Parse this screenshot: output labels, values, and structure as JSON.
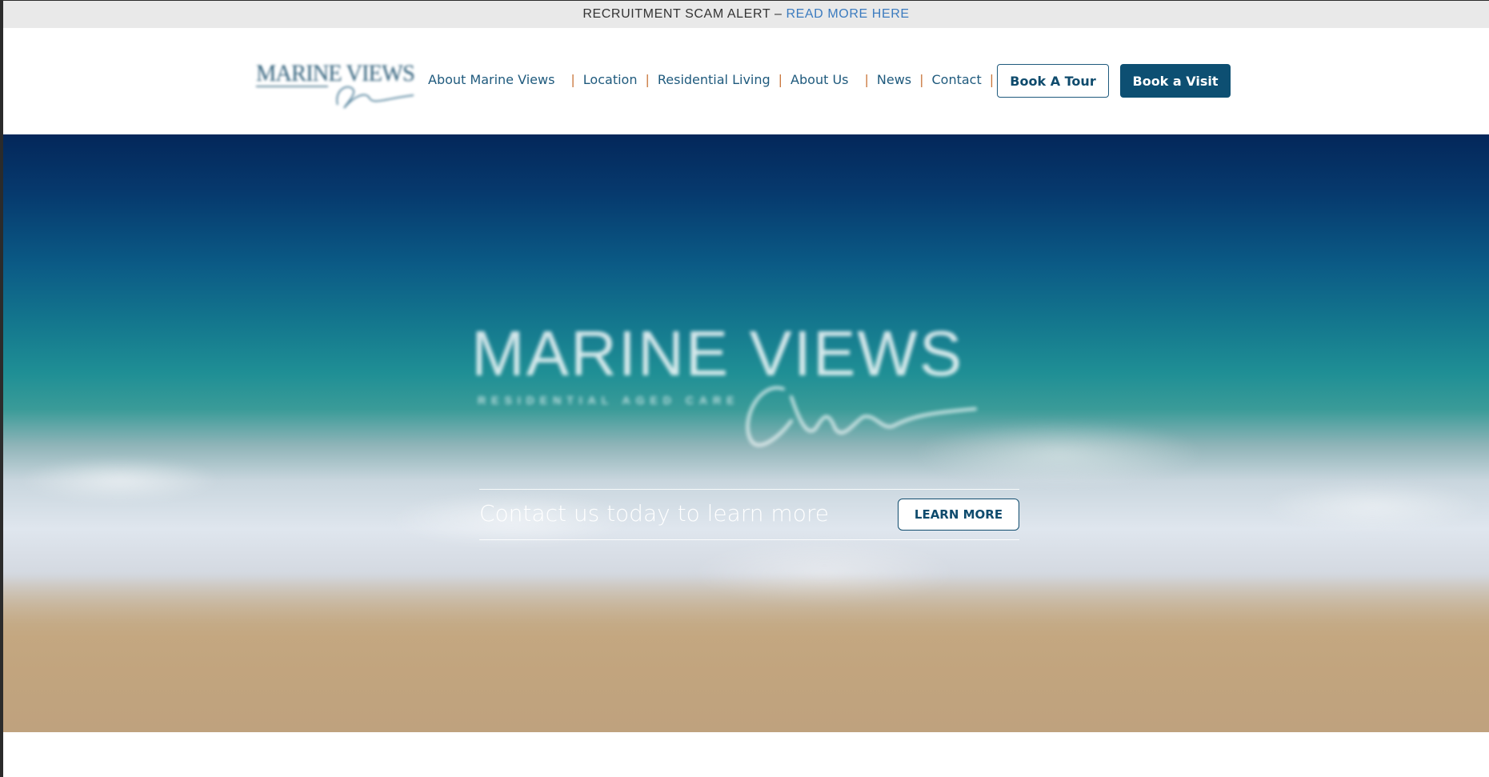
{
  "alert": {
    "text": "RECRUITMENT SCAM ALERT –",
    "link": "READ MORE HERE"
  },
  "header": {
    "logo_alt": "MARINE VIEWS",
    "nav": [
      {
        "label": "About Marine Views"
      },
      {
        "label": "Location"
      },
      {
        "label": "Residential Living"
      },
      {
        "label": "About Us"
      },
      {
        "label": "News"
      },
      {
        "label": "Contact"
      }
    ],
    "separator": "|",
    "book_tour_label": "Book A Tour",
    "book_visit_label": "Book a Visit"
  },
  "hero": {
    "logo_title": "MARINE VIEWS",
    "logo_subtitle": "RESIDENTIAL AGED CARE",
    "cta_text": "Contact us today to learn more",
    "learn_more_label": "LEARN MORE"
  },
  "colors": {
    "brand_navy": "#0d4f72",
    "nav_text": "#1f5a7d",
    "separator": "#c9763b",
    "alert_link": "#3b7bbf"
  }
}
